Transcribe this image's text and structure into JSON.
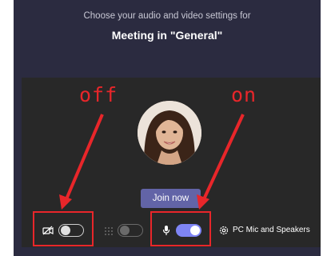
{
  "prejoin": {
    "subtitle": "Choose your audio and video settings for",
    "title": "Meeting in \"General\"",
    "join_button_label": "Join now"
  },
  "controls": {
    "video": {
      "icon": "camera-off-icon",
      "state": "off"
    },
    "blur": {
      "icon": "background-blur-icon",
      "state": "off"
    },
    "mic": {
      "icon": "microphone-icon",
      "state": "on"
    },
    "device_icon": "gear-icon",
    "device_label": "PC Mic and Speakers"
  },
  "annotations": {
    "off_label": "off",
    "on_label": "on",
    "color": "#e8262a"
  },
  "colors": {
    "background": "#2b2b40",
    "preview": "#282828",
    "accent": "#6264a7",
    "toggle_on": "#7f85f5"
  }
}
